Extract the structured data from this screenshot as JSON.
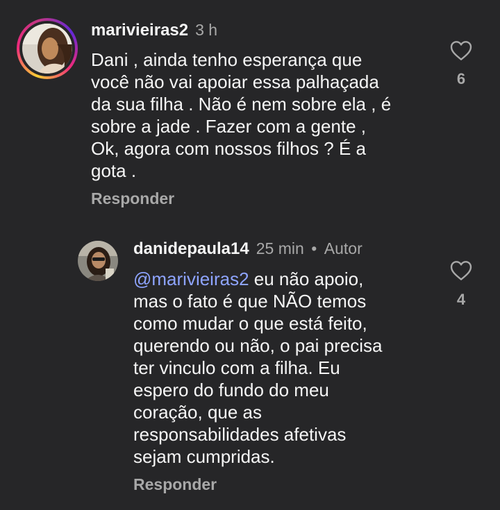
{
  "comments": [
    {
      "username": "marivieiras2",
      "time": "3 h",
      "text": "Dani , ainda tenho esperança que\nvocê não vai apoiar essa palhaçada\nda sua filha . Não é nem sobre ela , é\nsobre a jade . Fazer com a gente ,\nOk, agora com nossos filhos ? É a\ngota .",
      "reply_label": "Responder",
      "likes": "6"
    },
    {
      "username": "danidepaula14",
      "time": "25 min",
      "separator": "•",
      "author_label": "Autor",
      "mention": "@marivieiras2",
      "text": " eu não apoio,\nmas o fato é que  NÃO temos\ncomo mudar o que está feito,\nquerendo ou não, o pai precisa\nter vinculo com a filha.  Eu\nespero do fundo do meu\ncoração, que as\nresponsabilidades afetivas\nsejam cumpridas.",
      "reply_label": "Responder",
      "likes": "4"
    }
  ],
  "icons": {
    "like": "heart-outline-icon"
  }
}
